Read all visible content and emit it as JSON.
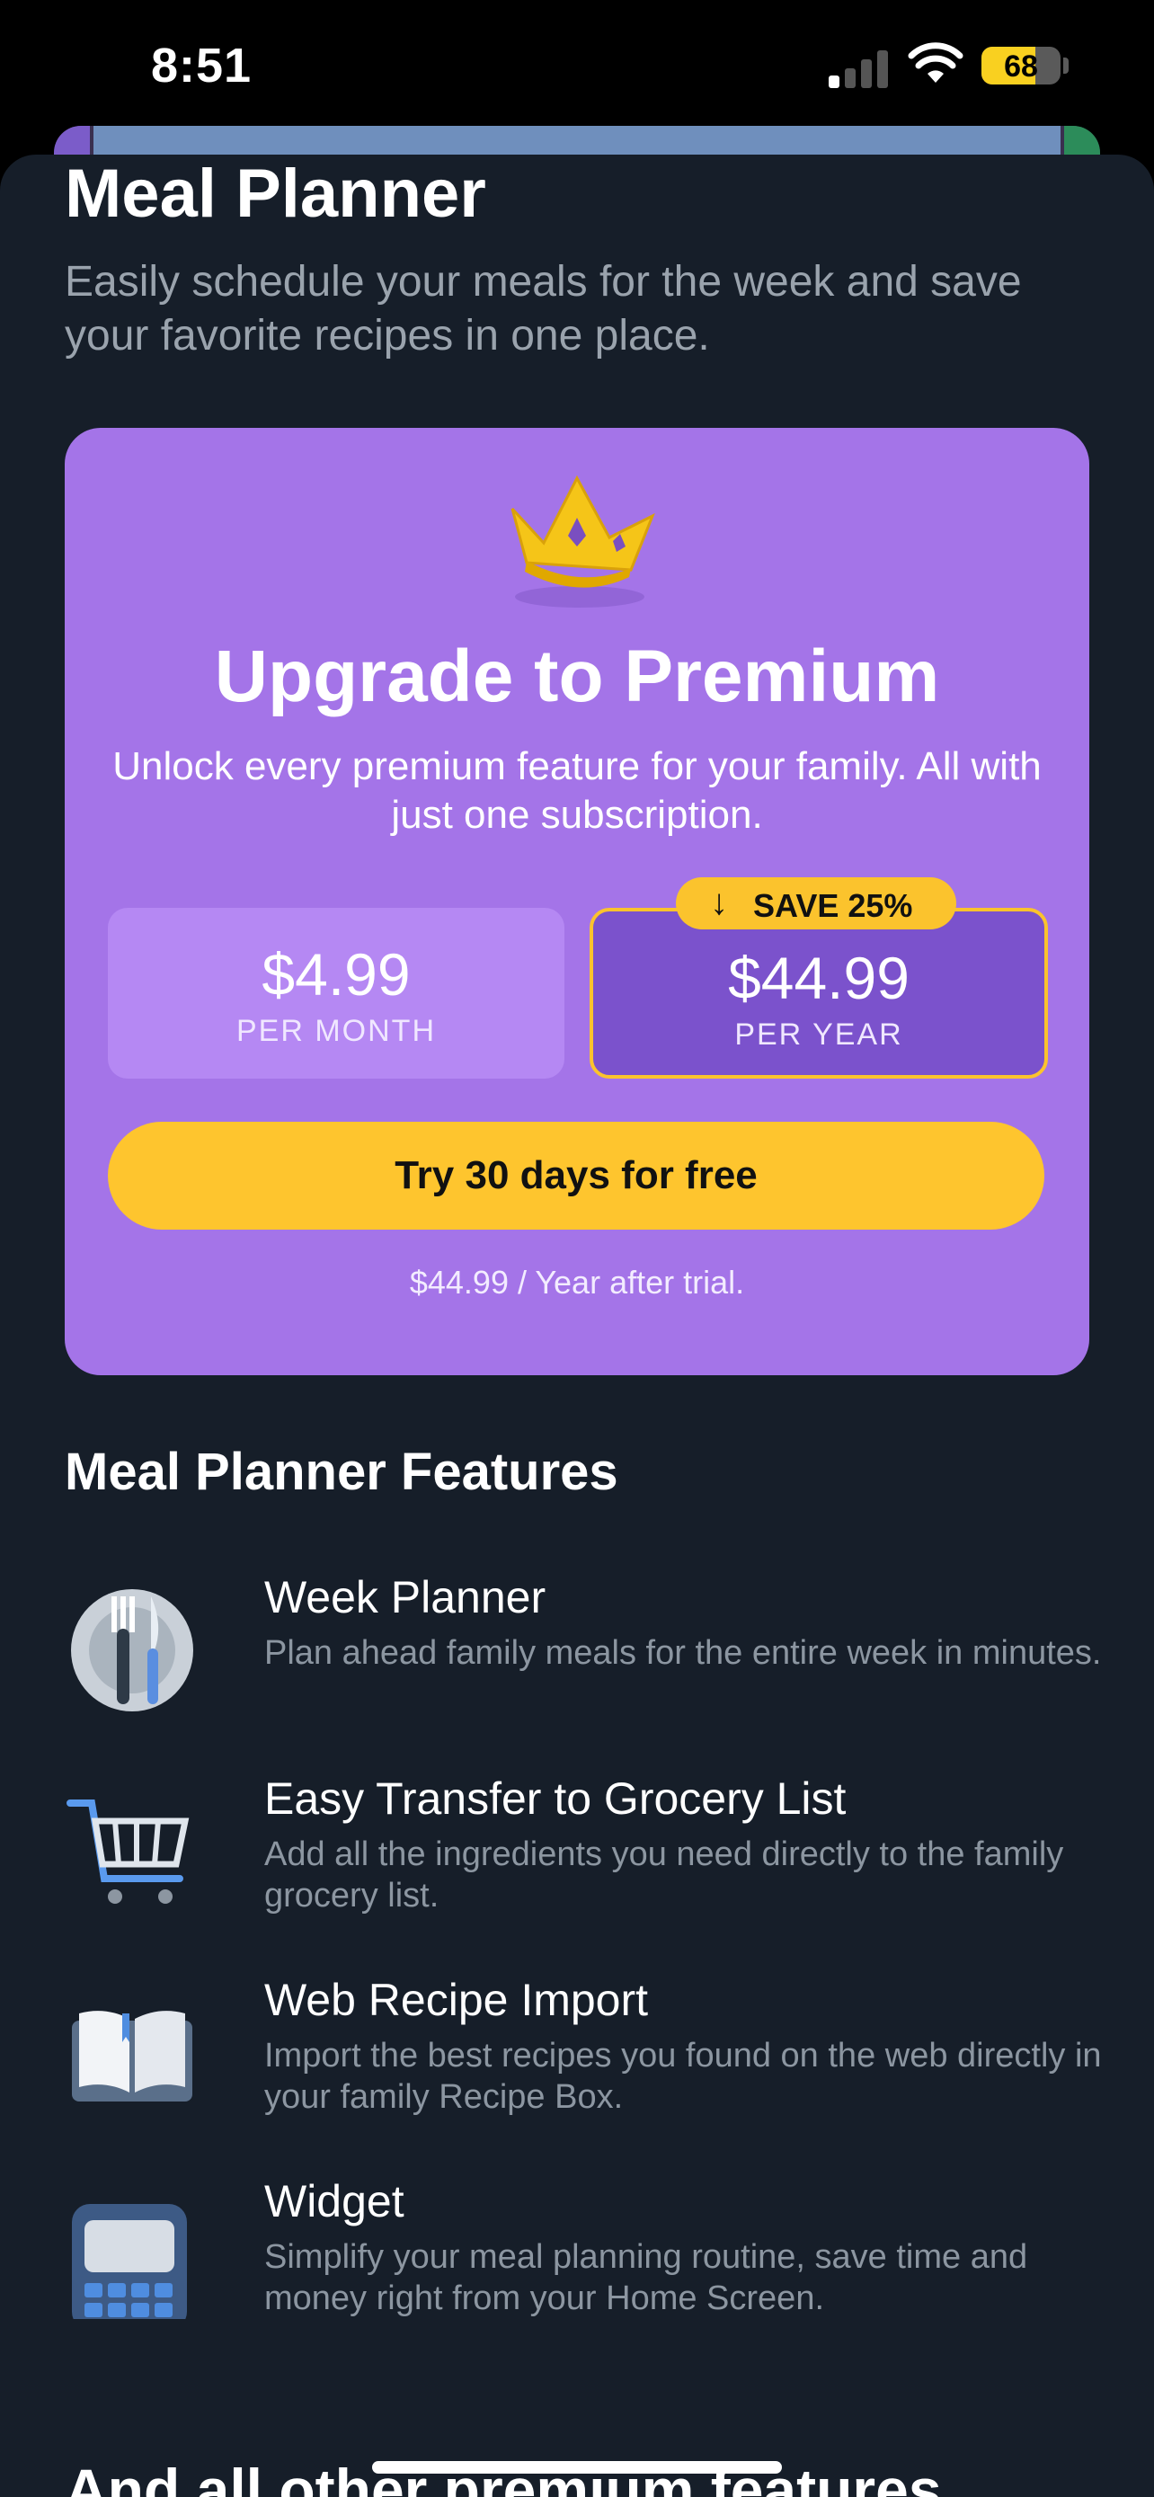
{
  "status_bar": {
    "time": "8:51",
    "battery_percent": "68",
    "battery_level": 0.68,
    "signal_bars_active": 1
  },
  "header": {
    "title": "Meal Planner",
    "subtitle": "Easily schedule your meals for the week and save your favorite recipes in one place."
  },
  "premium": {
    "title": "Upgrade to Premium",
    "description": "Unlock every premium feature for your family. All with just one subscription.",
    "plans": [
      {
        "price": "$4.99",
        "period": "PER MONTH",
        "selected": false
      },
      {
        "price": "$44.99",
        "period": "PER YEAR",
        "selected": true
      }
    ],
    "save_badge": "SAVE 25%",
    "cta_label": "Try 30 days for free",
    "after_trial_note": "$44.99 / Year after trial.",
    "colors": {
      "card": "#a474e8",
      "accent": "#fec52e",
      "selected_plan": "#7b52cc"
    }
  },
  "features": {
    "heading": "Meal Planner Features",
    "items": [
      {
        "icon": "fork-knife-plate-icon",
        "title": "Week Planner",
        "description": "Plan ahead family meals for the entire week in minutes."
      },
      {
        "icon": "shopping-cart-icon",
        "title": "Easy Transfer to Grocery List",
        "description": "Add all the ingredients you need directly to the family grocery list."
      },
      {
        "icon": "open-book-icon",
        "title": "Web Recipe Import",
        "description": "Import the best recipes you found on the web directly in your family Recipe Box."
      },
      {
        "icon": "phone-widget-icon",
        "title": "Widget",
        "description": "Simplify your meal planning routine, save time and money right from your Home Screen."
      }
    ]
  },
  "footer": {
    "more_heading": "And all other premium features"
  }
}
